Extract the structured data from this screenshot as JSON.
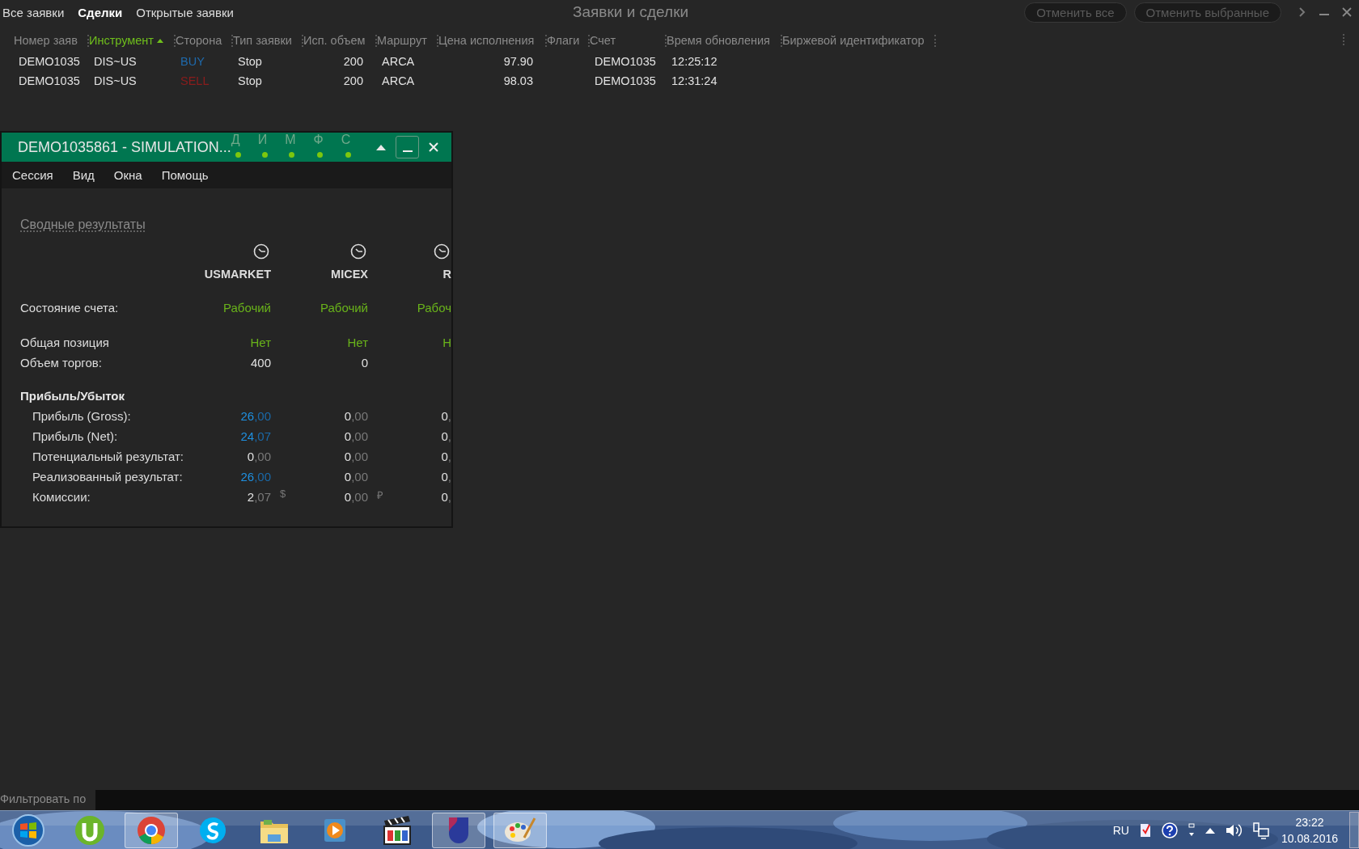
{
  "tabs": [
    {
      "label": "Все заявки",
      "selected": false
    },
    {
      "label": "Сделки",
      "selected": true
    },
    {
      "label": "Открытые заявки",
      "selected": false
    }
  ],
  "title": "Заявки и сделки",
  "toolbar_buttons": [
    {
      "label": "Отменить все",
      "disabled": true
    },
    {
      "label": "Отменить выбранные",
      "disabled": true
    }
  ],
  "table": {
    "columns": [
      {
        "label": "Номер заяв",
        "sorted": false
      },
      {
        "label": "Инструмент",
        "sorted": true
      },
      {
        "label": "Сторона",
        "sorted": false
      },
      {
        "label": "Тип заявки",
        "sorted": false
      },
      {
        "label": "Исп. объем",
        "sorted": false
      },
      {
        "label": "Маршрут",
        "sorted": false
      },
      {
        "label": "Цена исполнения",
        "sorted": false
      },
      {
        "label": "Флаги",
        "sorted": false
      },
      {
        "label": "Счет",
        "sorted": false
      },
      {
        "label": "Время обновления",
        "sorted": false
      },
      {
        "label": "Биржевой идентификатор",
        "sorted": false
      }
    ],
    "rows": [
      {
        "color": "#1e6aad",
        "cells": [
          "DEMO1035",
          "DIS~US",
          "BUY",
          "Stop",
          "200",
          "ARCA",
          "97.90",
          "",
          "DEMO1035",
          "12:25:12"
        ]
      },
      {
        "color": "#8a1c1c",
        "cells": [
          "DEMO1035",
          "DIS~US",
          "SELL",
          "Stop",
          "200",
          "ARCA",
          "98.03",
          "",
          "DEMO1035",
          "12:31:24"
        ]
      }
    ]
  },
  "dialog": {
    "title": "DEMO1035861 - SIMULATION...",
    "indicators": [
      {
        "label": "Д",
        "on": true
      },
      {
        "label": "И",
        "on": true
      },
      {
        "label": "М",
        "on": true
      },
      {
        "label": "Ф",
        "on": true
      },
      {
        "label": "С",
        "on": true
      }
    ],
    "menu": [
      "Сессия",
      "Вид",
      "Окна",
      "Помощь"
    ],
    "summary_link": "Сводные результаты",
    "exchanges": [
      "USMARKET",
      "MICEX",
      "R"
    ],
    "rows": [
      {
        "kind": "status",
        "label": "Состояние счета:",
        "values": [
          {
            "text": "Рабочий"
          },
          {
            "text": "Рабочий"
          },
          {
            "text": "Рабоч"
          }
        ]
      },
      {
        "kind": "status",
        "label": "Общая позиция",
        "values": [
          {
            "text": "Нет"
          },
          {
            "text": "Нет"
          },
          {
            "text": "Н"
          }
        ]
      },
      {
        "kind": "number",
        "label": "Объем торгов:",
        "values": [
          {
            "text": "400"
          },
          {
            "text": "0"
          }
        ]
      },
      {
        "kind": "header",
        "label": "Прибыль/Убыток"
      },
      {
        "kind": "money",
        "label": "Прибыль (Gross):",
        "values": [
          {
            "text": "26,00",
            "highlighted": true
          },
          {
            "text": "0,00",
            "highlighted": false
          },
          {
            "text": "0,",
            "highlighted": false
          }
        ]
      },
      {
        "kind": "money",
        "label": "Прибыль (Net):",
        "values": [
          {
            "text": "24,07",
            "highlighted": true
          },
          {
            "text": "0,00",
            "highlighted": false
          },
          {
            "text": "0,",
            "highlighted": false
          }
        ]
      },
      {
        "kind": "money",
        "label": "Потенциальный результат:",
        "values": [
          {
            "text": "0,00",
            "highlighted": false
          },
          {
            "text": "0,00",
            "highlighted": false
          },
          {
            "text": "0,",
            "highlighted": false
          }
        ]
      },
      {
        "kind": "money",
        "label": "Реализованный результат:",
        "values": [
          {
            "text": "26,00",
            "highlighted": true
          },
          {
            "text": "0,00",
            "highlighted": false
          },
          {
            "text": "0,",
            "highlighted": false
          }
        ]
      },
      {
        "kind": "money",
        "label": "Комиссии:",
        "values": [
          {
            "text": "2,07",
            "highlighted": false,
            "currency": "$"
          },
          {
            "text": "0,00",
            "highlighted": false,
            "currency": "₽"
          },
          {
            "text": "0,",
            "highlighted": false
          }
        ]
      }
    ]
  },
  "filter": {
    "label": "Фильтровать по"
  },
  "taskbar": {
    "items": [
      {
        "kind": "start",
        "active": false
      },
      {
        "kind": "torrent",
        "active": false
      },
      {
        "kind": "browser",
        "active": true
      },
      {
        "kind": "chat",
        "active": false
      },
      {
        "kind": "folder",
        "active": false
      },
      {
        "kind": "player",
        "active": false
      },
      {
        "kind": "video",
        "active": false
      },
      {
        "kind": "app",
        "active": true
      },
      {
        "kind": "paint",
        "active": true
      }
    ],
    "language": "RU",
    "time": "23:22",
    "date": "10.08.2016"
  }
}
